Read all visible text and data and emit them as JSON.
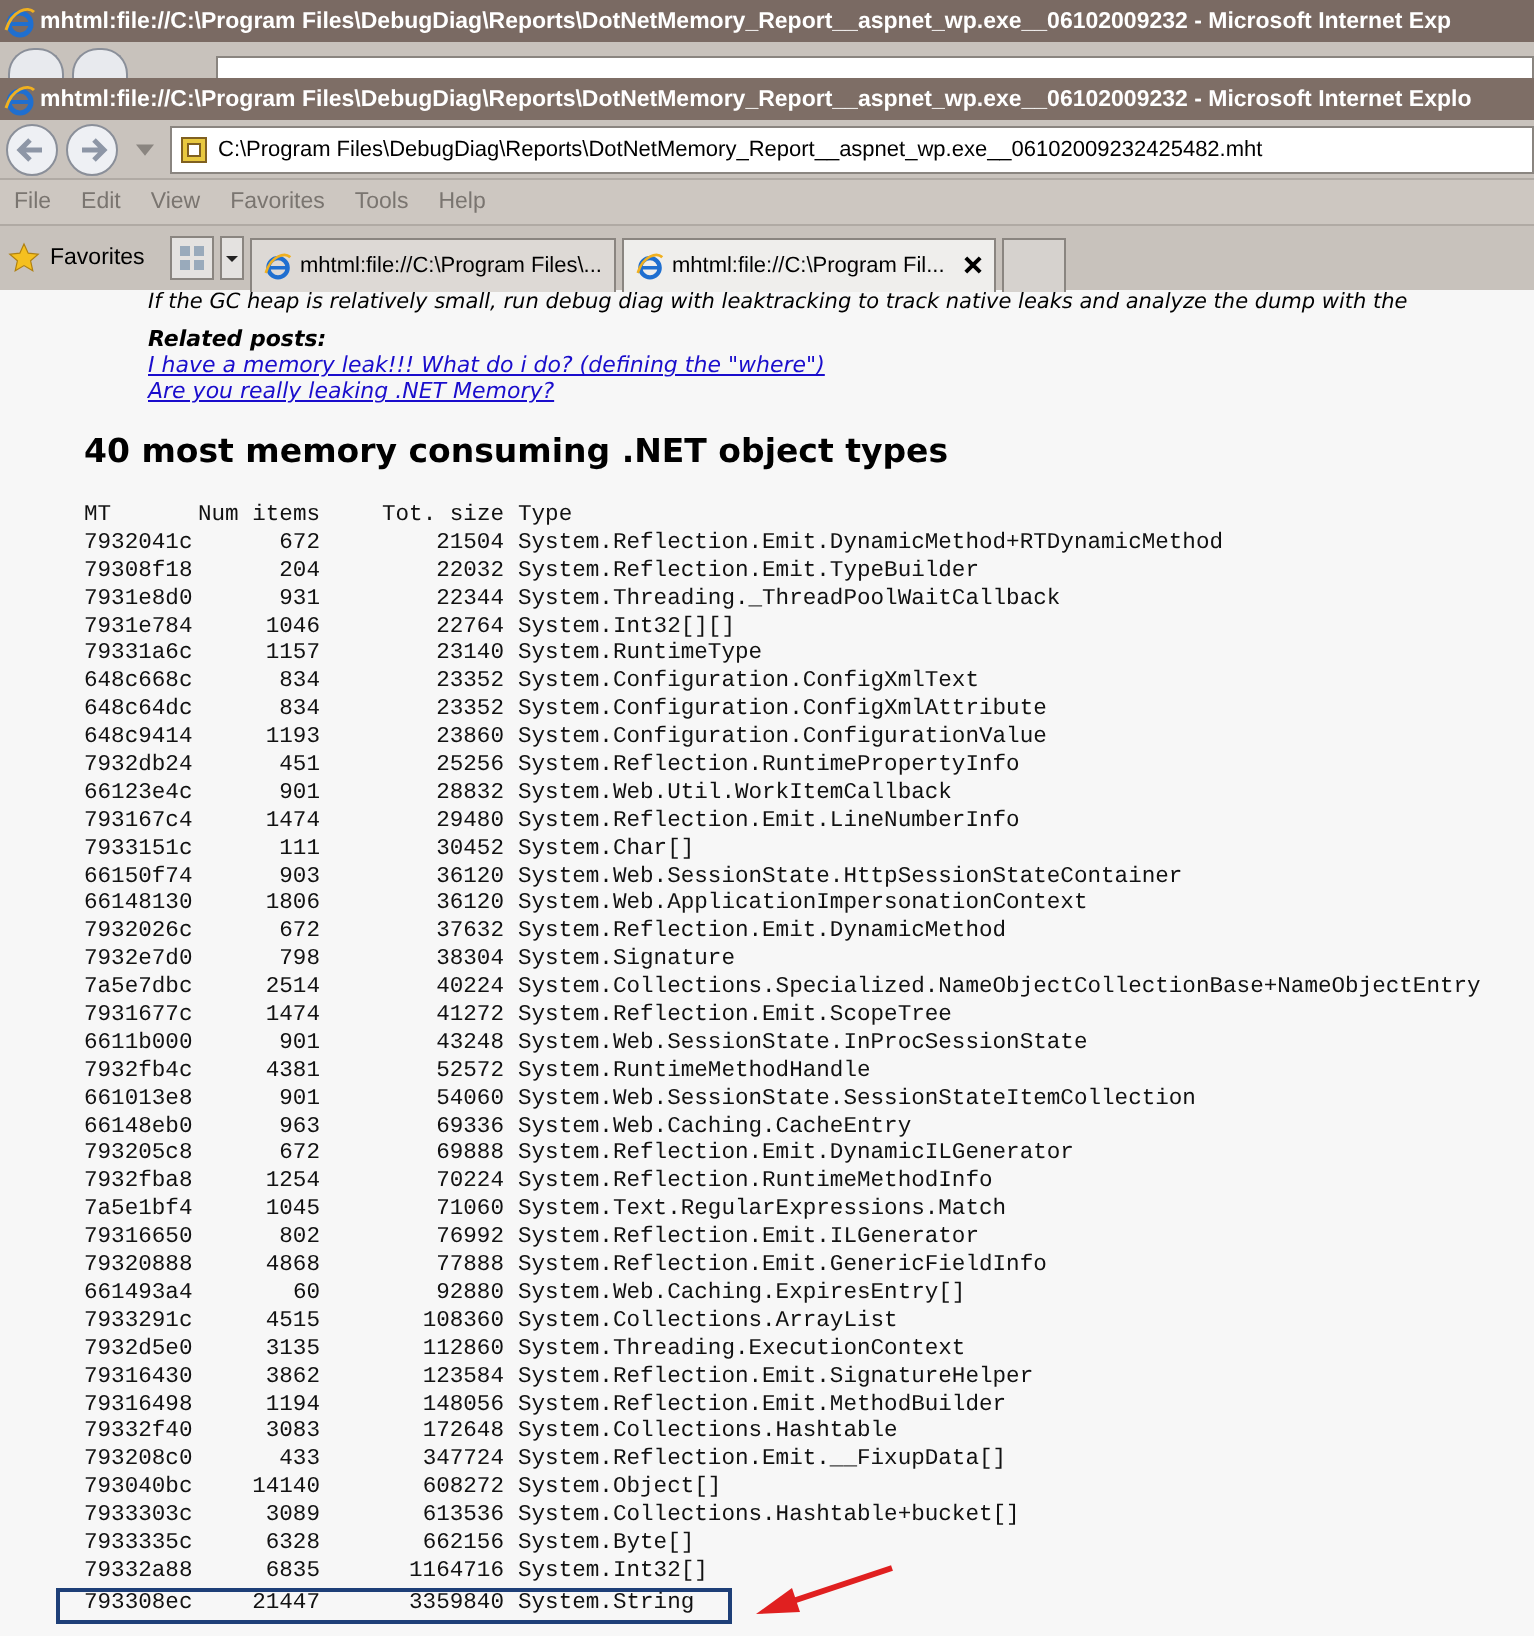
{
  "back_window": {
    "title": "mhtml:file://C:\\Program Files\\DebugDiag\\Reports\\DotNetMemory_Report__aspnet_wp.exe__06102009232 - Microsoft Internet Exp"
  },
  "window": {
    "title": "mhtml:file://C:\\Program Files\\DebugDiag\\Reports\\DotNetMemory_Report__aspnet_wp.exe__06102009232 - Microsoft Internet Explo"
  },
  "address_bar": {
    "value": "C:\\Program Files\\DebugDiag\\Reports\\DotNetMemory_Report__aspnet_wp.exe__06102009232425482.mht"
  },
  "menu": [
    "File",
    "Edit",
    "View",
    "Favorites",
    "Tools",
    "Help"
  ],
  "favorites": {
    "label": "Favorites"
  },
  "tabs": [
    {
      "label": "mhtml:file://C:\\Program Files\\...",
      "selected": false
    },
    {
      "label": "mhtml:file://C:\\Program Fil...",
      "selected": true
    }
  ],
  "content": {
    "intro": "If the GC heap is relatively small, run debug diag with leaktracking to track native leaks and analyze the dump with the",
    "related_heading": "Related posts:",
    "links": [
      "I have a memory leak!!! What do i do? (defining the \"where\")",
      "Are you really leaking .NET Memory?"
    ],
    "heading": "40 most memory consuming .NET object types",
    "table": {
      "columns": [
        "MT",
        "Num items",
        "Tot. size",
        "Type"
      ],
      "rows": [
        {
          "mt": "7932041c",
          "count": "672",
          "size": "21504",
          "type": "System.Reflection.Emit.DynamicMethod+RTDynamicMethod",
          "highlighted": false
        },
        {
          "mt": "79308f18",
          "count": "204",
          "size": "22032",
          "type": "System.Reflection.Emit.TypeBuilder",
          "highlighted": false
        },
        {
          "mt": "7931e8d0",
          "count": "931",
          "size": "22344",
          "type": "System.Threading._ThreadPoolWaitCallback",
          "highlighted": false
        },
        {
          "mt": "7931e784",
          "count": "1046",
          "size": "22764",
          "type": "System.Int32[][]",
          "highlighted": false
        },
        {
          "mt": "79331a6c",
          "count": "1157",
          "size": "23140",
          "type": "System.RuntimeType",
          "highlighted": false
        },
        {
          "mt": "648c668c",
          "count": "834",
          "size": "23352",
          "type": "System.Configuration.ConfigXmlText",
          "highlighted": false
        },
        {
          "mt": "648c64dc",
          "count": "834",
          "size": "23352",
          "type": "System.Configuration.ConfigXmlAttribute",
          "highlighted": false
        },
        {
          "mt": "648c9414",
          "count": "1193",
          "size": "23860",
          "type": "System.Configuration.ConfigurationValue",
          "highlighted": false
        },
        {
          "mt": "7932db24",
          "count": "451",
          "size": "25256",
          "type": "System.Reflection.RuntimePropertyInfo",
          "highlighted": false
        },
        {
          "mt": "66123e4c",
          "count": "901",
          "size": "28832",
          "type": "System.Web.Util.WorkItemCallback",
          "highlighted": false
        },
        {
          "mt": "793167c4",
          "count": "1474",
          "size": "29480",
          "type": "System.Reflection.Emit.LineNumberInfo",
          "highlighted": false
        },
        {
          "mt": "7933151c",
          "count": "111",
          "size": "30452",
          "type": "System.Char[]",
          "highlighted": false
        },
        {
          "mt": "66150f74",
          "count": "903",
          "size": "36120",
          "type": "System.Web.SessionState.HttpSessionStateContainer",
          "highlighted": false
        },
        {
          "mt": "66148130",
          "count": "1806",
          "size": "36120",
          "type": "System.Web.ApplicationImpersonationContext",
          "highlighted": false
        },
        {
          "mt": "7932026c",
          "count": "672",
          "size": "37632",
          "type": "System.Reflection.Emit.DynamicMethod",
          "highlighted": false
        },
        {
          "mt": "7932e7d0",
          "count": "798",
          "size": "38304",
          "type": "System.Signature",
          "highlighted": false
        },
        {
          "mt": "7a5e7dbc",
          "count": "2514",
          "size": "40224",
          "type": "System.Collections.Specialized.NameObjectCollectionBase+NameObjectEntry",
          "highlighted": false
        },
        {
          "mt": "7931677c",
          "count": "1474",
          "size": "41272",
          "type": "System.Reflection.Emit.ScopeTree",
          "highlighted": false
        },
        {
          "mt": "6611b000",
          "count": "901",
          "size": "43248",
          "type": "System.Web.SessionState.InProcSessionState",
          "highlighted": false
        },
        {
          "mt": "7932fb4c",
          "count": "4381",
          "size": "52572",
          "type": "System.RuntimeMethodHandle",
          "highlighted": false
        },
        {
          "mt": "661013e8",
          "count": "901",
          "size": "54060",
          "type": "System.Web.SessionState.SessionStateItemCollection",
          "highlighted": false
        },
        {
          "mt": "66148eb0",
          "count": "963",
          "size": "69336",
          "type": "System.Web.Caching.CacheEntry",
          "highlighted": false
        },
        {
          "mt": "793205c8",
          "count": "672",
          "size": "69888",
          "type": "System.Reflection.Emit.DynamicILGenerator",
          "highlighted": false
        },
        {
          "mt": "7932fba8",
          "count": "1254",
          "size": "70224",
          "type": "System.Reflection.RuntimeMethodInfo",
          "highlighted": false
        },
        {
          "mt": "7a5e1bf4",
          "count": "1045",
          "size": "71060",
          "type": "System.Text.RegularExpressions.Match",
          "highlighted": false
        },
        {
          "mt": "79316650",
          "count": "802",
          "size": "76992",
          "type": "System.Reflection.Emit.ILGenerator",
          "highlighted": false
        },
        {
          "mt": "79320888",
          "count": "4868",
          "size": "77888",
          "type": "System.Reflection.Emit.GenericFieldInfo",
          "highlighted": false
        },
        {
          "mt": "661493a4",
          "count": "60",
          "size": "92880",
          "type": "System.Web.Caching.ExpiresEntry[]",
          "highlighted": false
        },
        {
          "mt": "7933291c",
          "count": "4515",
          "size": "108360",
          "type": "System.Collections.ArrayList",
          "highlighted": false
        },
        {
          "mt": "7932d5e0",
          "count": "3135",
          "size": "112860",
          "type": "System.Threading.ExecutionContext",
          "highlighted": false
        },
        {
          "mt": "79316430",
          "count": "3862",
          "size": "123584",
          "type": "System.Reflection.Emit.SignatureHelper",
          "highlighted": false
        },
        {
          "mt": "79316498",
          "count": "1194",
          "size": "148056",
          "type": "System.Reflection.Emit.MethodBuilder",
          "highlighted": false
        },
        {
          "mt": "79332f40",
          "count": "3083",
          "size": "172648",
          "type": "System.Collections.Hashtable",
          "highlighted": false
        },
        {
          "mt": "793208c0",
          "count": "433",
          "size": "347724",
          "type": "System.Reflection.Emit.__FixupData[]",
          "highlighted": false
        },
        {
          "mt": "793040bc",
          "count": "14140",
          "size": "608272",
          "type": "System.Object[]",
          "highlighted": false
        },
        {
          "mt": "7933303c",
          "count": "3089",
          "size": "613536",
          "type": "System.Collections.Hashtable+bucket[]",
          "highlighted": false
        },
        {
          "mt": "7933335c",
          "count": "6328",
          "size": "662156",
          "type": "System.Byte[]",
          "highlighted": false
        },
        {
          "mt": "79332a88",
          "count": "6835",
          "size": "1164716",
          "type": "System.Int32[]",
          "highlighted": false
        },
        {
          "mt": "793308ec",
          "count": "21447",
          "size": "3359840",
          "type": "System.String",
          "highlighted": true
        }
      ]
    }
  }
}
